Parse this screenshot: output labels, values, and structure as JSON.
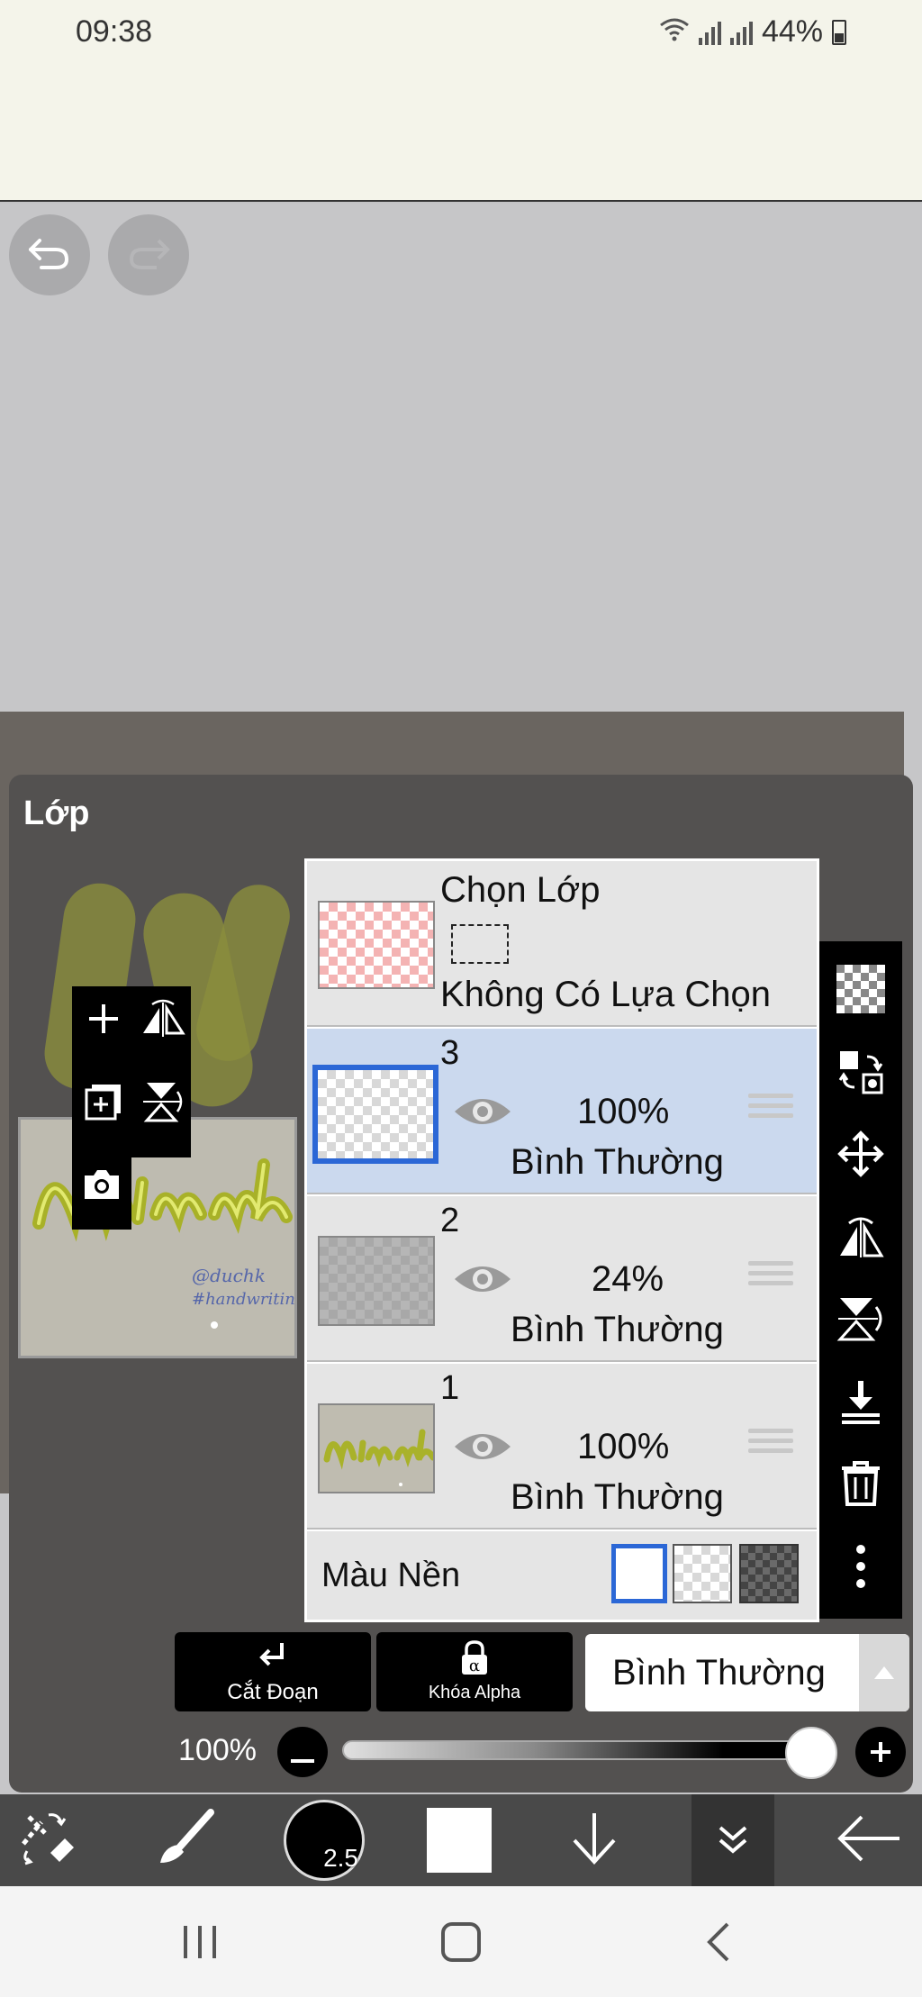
{
  "status_bar": {
    "time": "09:38",
    "battery": "44%"
  },
  "layer_panel": {
    "title": "Lớp",
    "selection_row": {
      "title": "Chọn Lớp",
      "subtitle": "Không Có Lựa Chọn"
    },
    "layers": [
      {
        "number": "3",
        "opacity": "100%",
        "blend": "Bình Thường",
        "selected": true
      },
      {
        "number": "2",
        "opacity": "24%",
        "blend": "Bình Thường",
        "selected": false
      },
      {
        "number": "1",
        "opacity": "100%",
        "blend": "Bình Thường",
        "selected": false
      }
    ],
    "background_color_label": "Màu Nền",
    "clip_button_label": "Cắt Đoạn",
    "alpha_lock_label": "Khóa Alpha",
    "blend_mode_value": "Bình Thường",
    "opacity_value": "100%",
    "opacity_fraction": 1.0
  },
  "bottom_toolbar": {
    "brush_size": "2.5"
  },
  "icons": [
    "undo-icon",
    "redo-icon",
    "plus-icon",
    "flip-horizontal-icon",
    "add-layer-icon",
    "flip-vertical-icon",
    "camera-icon",
    "transparent-icon",
    "swap-icon",
    "move-icon",
    "merge-down-icon",
    "trash-icon",
    "more-icon",
    "eye-icon",
    "drag-handle-icon",
    "brush-icon",
    "arrow-down-icon",
    "chevron-double-down-icon",
    "back-arrow-icon"
  ]
}
